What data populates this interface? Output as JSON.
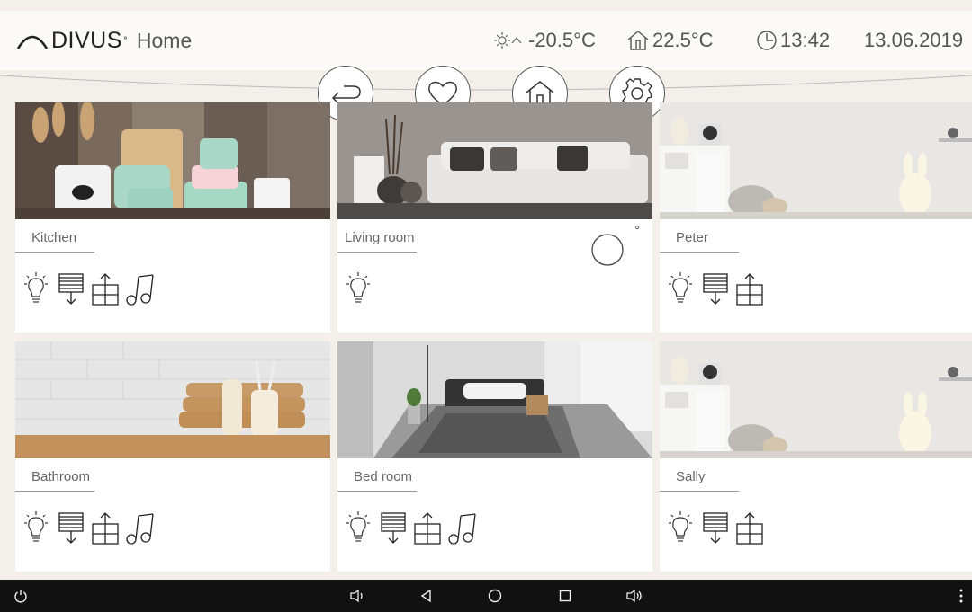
{
  "header": {
    "brand": "DIVUS",
    "brand_mark": "°",
    "title": "Home",
    "outdoor_temp": "-20.5°C",
    "indoor_temp": "22.5°C",
    "time": "13:42",
    "date": "13.06.2019",
    "icons": [
      "weather-icon",
      "house-temp-icon",
      "clock-icon"
    ]
  },
  "nav": [
    {
      "name": "back",
      "icon": "back-arrow-icon"
    },
    {
      "name": "favorites",
      "icon": "heart-icon"
    },
    {
      "name": "home",
      "icon": "home-icon"
    },
    {
      "name": "settings",
      "icon": "gear-icon"
    }
  ],
  "rooms": [
    {
      "name": "Kitchen",
      "icons": [
        "bulb-icon",
        "blind-down-icon",
        "window-up-icon",
        "music-icon"
      ]
    },
    {
      "name": "Living room",
      "icons": [
        "bulb-icon"
      ],
      "thermostat": "°"
    },
    {
      "name": "Peter",
      "icons": [
        "bulb-icon",
        "blind-down-icon",
        "window-up-icon"
      ]
    },
    {
      "name": "Bathroom",
      "icons": [
        "bulb-icon",
        "blind-down-icon",
        "window-up-icon",
        "music-icon"
      ]
    },
    {
      "name": "Bed room",
      "icons": [
        "bulb-icon",
        "blind-down-icon",
        "window-up-icon",
        "music-icon"
      ]
    },
    {
      "name": "Sally",
      "icons": [
        "bulb-icon",
        "blind-down-icon",
        "window-up-icon"
      ]
    }
  ],
  "system_bar": [
    "power-icon",
    "volume-down-icon",
    "back-triangle-icon",
    "home-circle-icon",
    "recents-square-icon",
    "volume-up-icon",
    "menu-dots-icon"
  ],
  "colors": {
    "background": "#f3efeb",
    "header": "#fbfaf9",
    "tile": "#ffffff",
    "icon_stroke": "#333333",
    "system_bar": "#111111"
  }
}
